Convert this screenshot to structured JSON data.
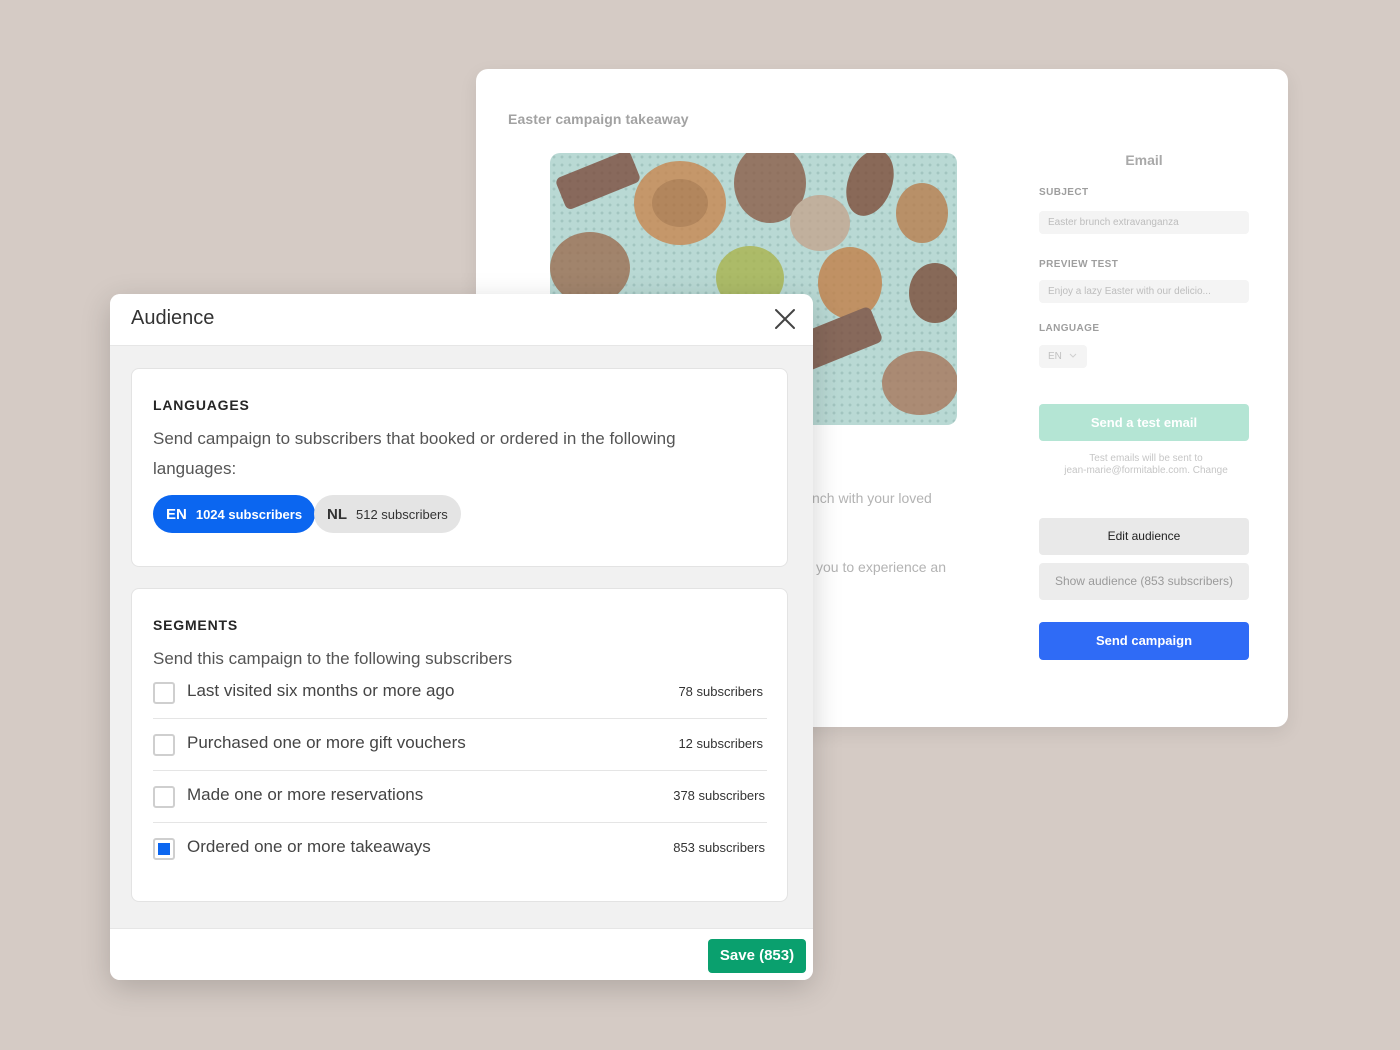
{
  "campaign": {
    "title": "Easter campaign takeaway",
    "image_alt": "pastries-photo",
    "snippet_line1": "nch with your loved",
    "snippet_line2": "you to experience an",
    "sidebar": {
      "heading": "Email",
      "subject_label": "SUBJECT",
      "subject_value": "Easter brunch extravanganza",
      "preview_label": "PREVIEW TEST",
      "preview_value": "Enjoy a lazy Easter with our delicio...",
      "language_label": "LANGUAGE",
      "language_value": "EN",
      "test_button": "Send a test email",
      "test_note_line1": "Test emails will be sent to",
      "test_note_line2": "jean-marie@formitable.com. Change",
      "edit_audience_button": "Edit audience",
      "show_audience_button": "Show audience (853 subscribers)",
      "send_button": "Send campaign"
    }
  },
  "modal": {
    "title": "Audience",
    "languages": {
      "heading": "LANGUAGES",
      "description": "Send campaign to subscribers that booked or ordered in the following languages:",
      "pills": [
        {
          "code": "EN",
          "count": "1024 subscribers",
          "selected": true
        },
        {
          "code": "NL",
          "count": "512 subscribers",
          "selected": false
        }
      ]
    },
    "segments": {
      "heading": "SEGMENTS",
      "description": "Send this campaign to the following subscribers",
      "items": [
        {
          "label": "Last visited six months or more ago",
          "count": "78 subscribers",
          "checked": false
        },
        {
          "label": "Purchased one or more gift vouchers",
          "count": "12 subscribers",
          "checked": false
        },
        {
          "label": "Made one or more reservations",
          "count": "378 subscribers",
          "checked": false
        },
        {
          "label": "Ordered one or more takeaways",
          "count": "853 subscribers",
          "checked": true
        }
      ]
    },
    "save_button": "Save (853)"
  },
  "colors": {
    "background": "#d5cbc5",
    "primary_blue": "#0b66f0",
    "send_blue": "#2f6bf6",
    "save_green": "#0aa06e",
    "test_green": "#b4e5d4"
  }
}
